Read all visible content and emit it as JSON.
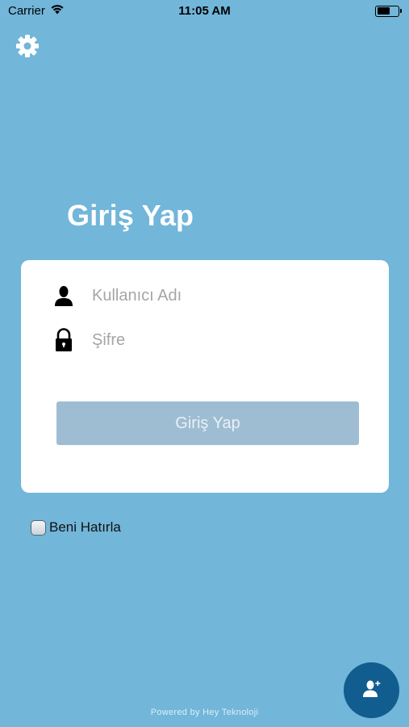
{
  "status_bar": {
    "carrier": "Carrier",
    "time": "11:05 AM",
    "wifi_icon": "wifi-icon",
    "battery_icon": "battery-icon",
    "battery_level": 0.6
  },
  "settings": {
    "icon": "gear-icon"
  },
  "title": "Giriş Yap",
  "form": {
    "username": {
      "placeholder": "Kullanıcı Adı",
      "value": "",
      "icon": "user-icon"
    },
    "password": {
      "placeholder": "Şifre",
      "value": "",
      "icon": "lock-icon"
    },
    "submit_label": "Giriş Yap"
  },
  "remember_me": {
    "label": "Beni Hatırla",
    "checked": false
  },
  "footer": {
    "powered_by": "Powered by Hey Teknoloji"
  },
  "fab": {
    "icon": "add-user-icon"
  },
  "colors": {
    "background": "#72b6d9",
    "card": "#ffffff",
    "button": "#9fbdd2",
    "fab": "#125d8f",
    "title": "#ffffff"
  }
}
